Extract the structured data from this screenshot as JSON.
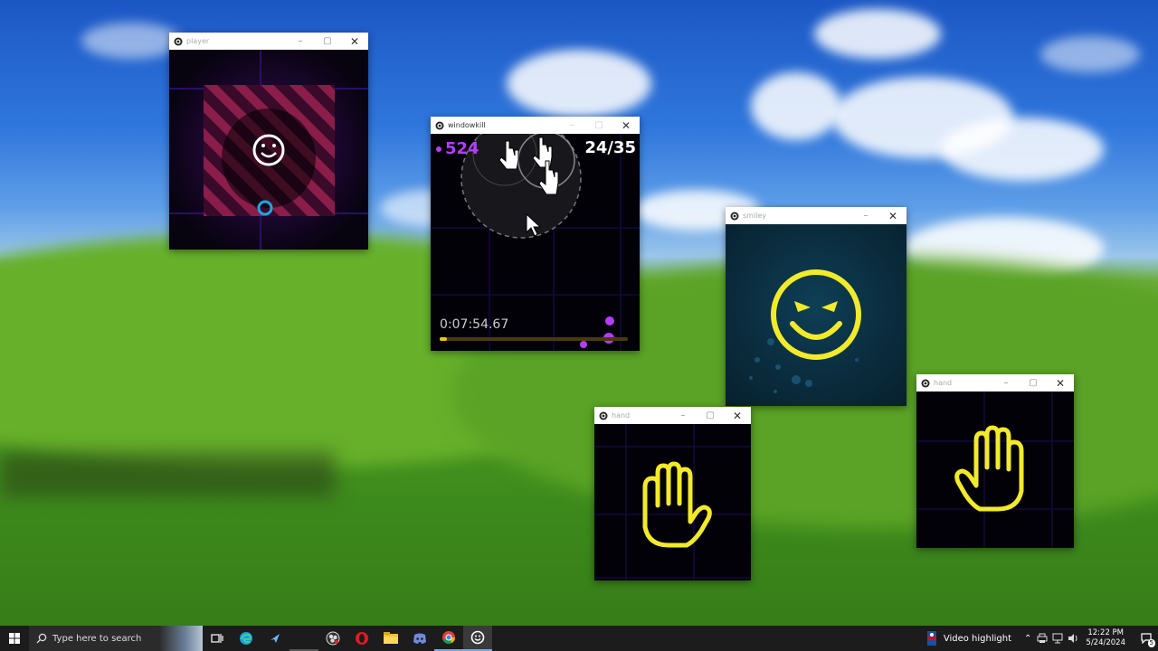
{
  "windows": {
    "player": {
      "title": "player"
    },
    "main": {
      "title": "windowkill",
      "score": "524",
      "wave": "24/35",
      "timer": "0:07:54.67",
      "progress_fraction": 0.04
    },
    "smiley": {
      "title": "smiley"
    },
    "hand1": {
      "title": "hand"
    },
    "hand2": {
      "title": "hand"
    }
  },
  "taskbar": {
    "search_placeholder": "Type here to search",
    "notification_label": "Video highlight",
    "time": "12:22 PM",
    "date": "5/24/2024",
    "notification_count": "5",
    "pinned_icons": [
      "task-view-icon",
      "edge-icon",
      "steam-icon",
      "blank-icon",
      "obs-icon",
      "opera-icon",
      "file-explorer-icon",
      "discord-icon",
      "chrome-icon",
      "windowkill-icon"
    ]
  },
  "colors": {
    "accent_purple": "#b43cff",
    "hand_yellow": "#f2ea2a",
    "stripe_red": "#8a1d4a",
    "ring_cyan": "#18a8e8"
  }
}
